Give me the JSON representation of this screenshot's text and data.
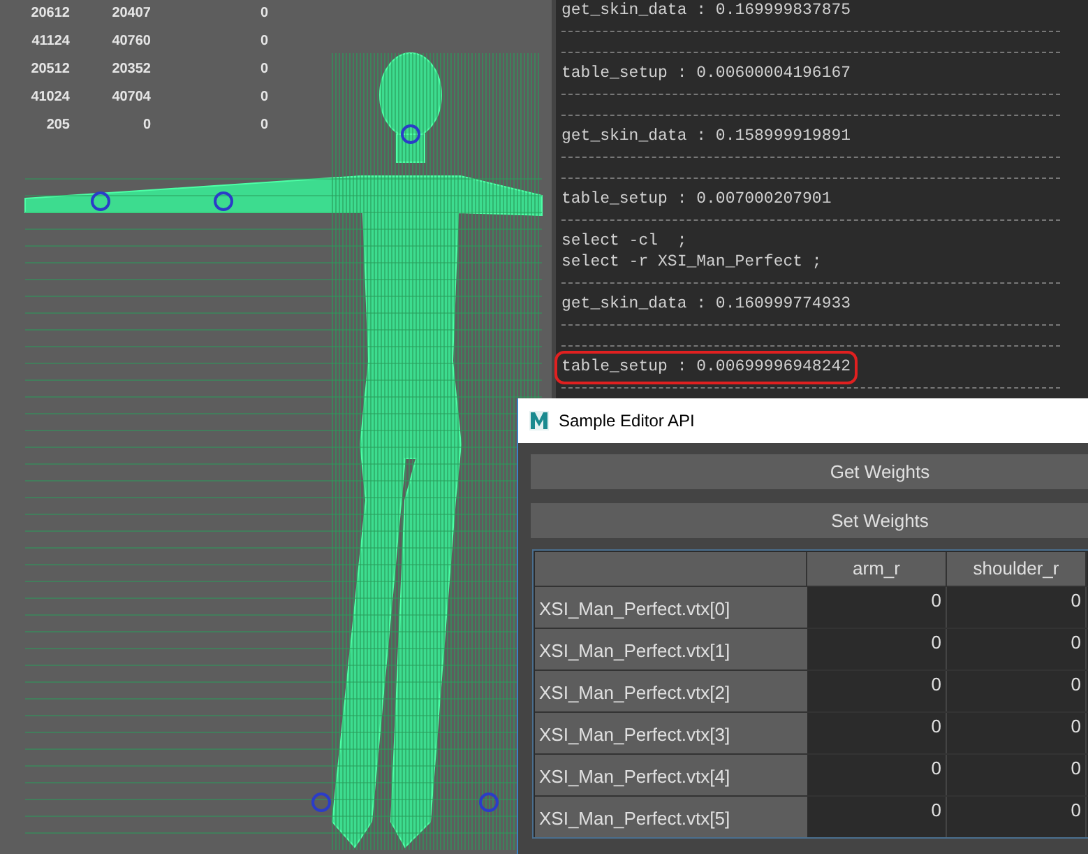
{
  "viewport": {
    "stats": [
      [
        "20612",
        "20407",
        "0"
      ],
      [
        "41124",
        "40760",
        "0"
      ],
      [
        "20512",
        "20352",
        "0"
      ],
      [
        "41024",
        "40704",
        "0"
      ],
      [
        "205",
        "0",
        "0"
      ]
    ]
  },
  "script_output": {
    "lines": [
      {
        "kind": "text",
        "text": "get_skin_data : 0.169999837875",
        "highlighted": false
      },
      {
        "kind": "rule"
      },
      {
        "kind": "rule"
      },
      {
        "kind": "text",
        "text": "table_setup : 0.00600004196167",
        "highlighted": false
      },
      {
        "kind": "rule"
      },
      {
        "kind": "rule"
      },
      {
        "kind": "text",
        "text": "get_skin_data : 0.158999919891",
        "highlighted": false
      },
      {
        "kind": "rule"
      },
      {
        "kind": "rule"
      },
      {
        "kind": "text",
        "text": "table_setup : 0.007000207901",
        "highlighted": false
      },
      {
        "kind": "rule"
      },
      {
        "kind": "text",
        "text": "select -cl  ;",
        "highlighted": false
      },
      {
        "kind": "text",
        "text": "select -r XSI_Man_Perfect ;",
        "highlighted": false
      },
      {
        "kind": "rule"
      },
      {
        "kind": "text",
        "text": "get_skin_data : 0.160999774933",
        "highlighted": false
      },
      {
        "kind": "rule"
      },
      {
        "kind": "rule"
      },
      {
        "kind": "text",
        "text": "table_setup : 0.00699996948242",
        "highlighted": true
      },
      {
        "kind": "rule"
      }
    ]
  },
  "editor_window": {
    "title": "Sample Editor API",
    "buttons": [
      "Get Weights",
      "Set Weights"
    ],
    "table": {
      "columns": [
        "arm_r",
        "shoulder_r"
      ],
      "rows": [
        {
          "label": "XSI_Man_Perfect.vtx[0]",
          "cells": [
            "0",
            "0"
          ]
        },
        {
          "label": "XSI_Man_Perfect.vtx[1]",
          "cells": [
            "0",
            "0"
          ]
        },
        {
          "label": "XSI_Man_Perfect.vtx[2]",
          "cells": [
            "0",
            "0"
          ]
        },
        {
          "label": "XSI_Man_Perfect.vtx[3]",
          "cells": [
            "0",
            "0"
          ]
        },
        {
          "label": "XSI_Man_Perfect.vtx[4]",
          "cells": [
            "0",
            "0"
          ]
        },
        {
          "label": "XSI_Man_Perfect.vtx[5]",
          "cells": [
            "0",
            "0"
          ]
        }
      ]
    }
  }
}
